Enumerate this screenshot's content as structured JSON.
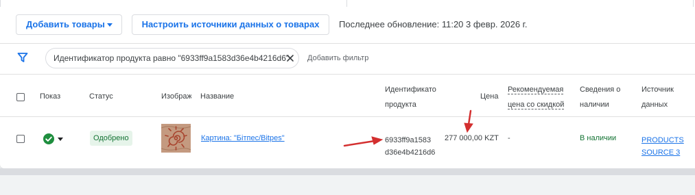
{
  "toolbar": {
    "add_products_label": "Добавить товары",
    "configure_sources_label": "Настроить источники данных о товарах",
    "last_update": "Последнее обновление: 11:20 3 февр. 2026 г."
  },
  "filter": {
    "chip_label": "Идентификатор продукта равно \"6933ff9a1583d36e4b4216d6\"",
    "add_filter_label": "Добавить фильтр"
  },
  "table": {
    "headers": {
      "show": "Показ",
      "status": "Статус",
      "image": "Изображ",
      "name": "Название",
      "product_id_line1": "Идентификато",
      "product_id_line2": "продукта",
      "price": "Цена",
      "sale_price_line1": "Рекомендуемая",
      "sale_price_line2": "цена со скидкой",
      "availability_line1": "Сведения о",
      "availability_line2": "наличии",
      "source_line1": "Источник",
      "source_line2": "данных"
    },
    "rows": [
      {
        "status": "Одобрено",
        "name": "Картина: \"Бітпес/Bitpes\"",
        "product_id_line1": "6933ff9a1583",
        "product_id_line2": "d36e4b4216d6",
        "price": "277 000,00 KZT",
        "sale_price": "-",
        "availability": "В наличии",
        "source_line1": "PRODUCTS",
        "source_line2": "SOURCE 3",
        "show_icon": "check-circle-icon"
      }
    ]
  },
  "colors": {
    "accent": "#1a73e8",
    "approved_bg": "#e6f4ea",
    "approved_text": "#137333",
    "check_green": "#1e8e3e",
    "annotation_arrow": "#d32f2f"
  }
}
